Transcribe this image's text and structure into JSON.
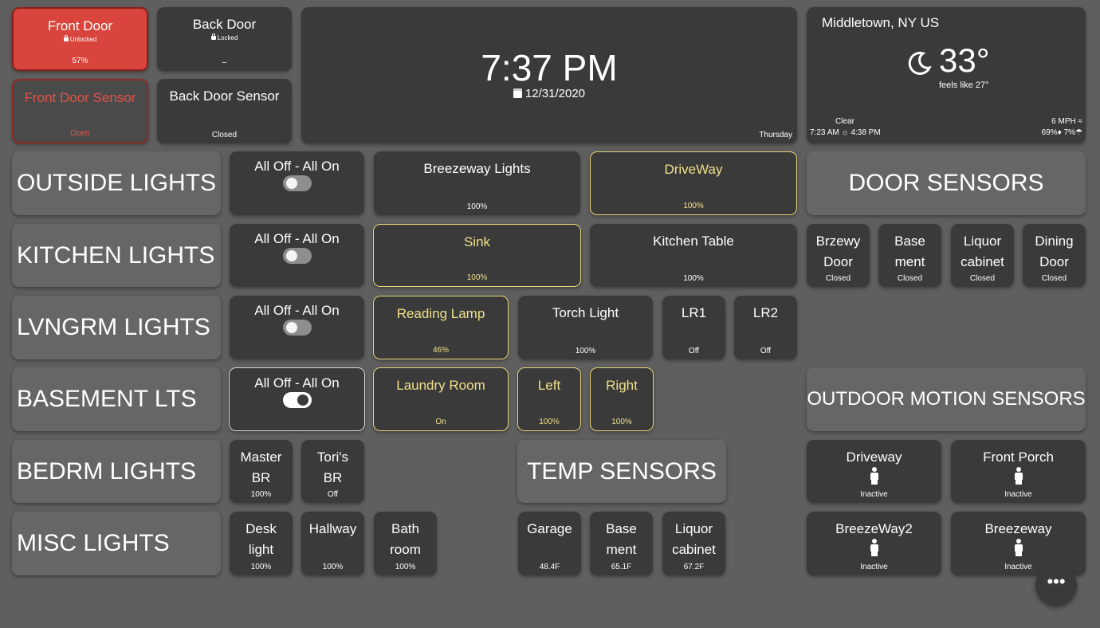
{
  "doors": {
    "front_door": {
      "name": "Front Door",
      "lock": "Unlocked",
      "status": "57%"
    },
    "back_door": {
      "name": "Back Door",
      "lock": "Locked",
      "status": "–"
    },
    "front_door_sensor": {
      "name": "Front Door Sensor",
      "status": "Open"
    },
    "back_door_sensor": {
      "name": "Back Door Sensor",
      "status": "Closed"
    }
  },
  "clock": {
    "time": "7:37 PM",
    "date": "12/31/2020",
    "weekday": "Thursday"
  },
  "weather": {
    "location": "Middletown, NY US",
    "temp": "33°",
    "feels_like": "feels like 27°",
    "condition": "Clear",
    "sunrise": "7:23 AM",
    "sunset": "4:38 PM",
    "wind": "6 MPH",
    "humidity": "69%",
    "precip": "7%"
  },
  "headers": {
    "outside": "OUTSIDE LIGHTS",
    "kitchen": "KITCHEN LIGHTS",
    "lvngrm": "LVNGRM LIGHTS",
    "basement": "BASEMENT LTS",
    "bedrm": "BEDRM LIGHTS",
    "misc": "MISC LIGHTS",
    "door_sensors": "DOOR SENSORS",
    "outdoor_motion": "OUTDOOR MOTION SENSORS",
    "temp_sensors": "TEMP SENSORS"
  },
  "toggle_label": "All Off - All On",
  "outside": {
    "breezeway": {
      "name": "Breezeway Lights",
      "status": "100%"
    },
    "driveway": {
      "name": "DriveWay",
      "status": "100%"
    }
  },
  "kitchen": {
    "sink": {
      "name": "Sink",
      "status": "100%"
    },
    "table": {
      "name": "Kitchen Table",
      "status": "100%"
    }
  },
  "lvngrm": {
    "reading": {
      "name": "Reading Lamp",
      "status": "46%"
    },
    "torch": {
      "name": "Torch Light",
      "status": "100%"
    },
    "lr1": {
      "name": "LR1",
      "status": "Off"
    },
    "lr2": {
      "name": "LR2",
      "status": "Off"
    }
  },
  "basement": {
    "laundry": {
      "name": "Laundry Room",
      "status": "On"
    },
    "left": {
      "name": "Left",
      "status": "100%"
    },
    "right": {
      "name": "Right",
      "status": "100%"
    }
  },
  "bedrm": {
    "master": {
      "line1": "Master",
      "line2": "BR",
      "status": "100%"
    },
    "tori": {
      "line1": "Tori's",
      "line2": "BR",
      "status": "Off"
    }
  },
  "misc": {
    "desk": {
      "line1": "Desk",
      "line2": "light",
      "status": "100%"
    },
    "hallway": {
      "line1": "Hallway",
      "line2": "",
      "status": "100%"
    },
    "bath": {
      "line1": "Bath",
      "line2": "room",
      "status": "100%"
    }
  },
  "door_sensor_tiles": {
    "brzewy": {
      "line1": "Brzewy",
      "line2": "Door",
      "status": "Closed"
    },
    "basement": {
      "line1": "Base",
      "line2": "ment",
      "status": "Closed"
    },
    "liquor": {
      "line1": "Liquor",
      "line2": "cabinet",
      "status": "Closed"
    },
    "dining": {
      "line1": "Dining",
      "line2": "Door",
      "status": "Closed"
    }
  },
  "temp_tiles": {
    "garage": {
      "line1": "Garage",
      "line2": "",
      "status": "48.4F"
    },
    "basement": {
      "line1": "Base",
      "line2": "ment",
      "status": "65.1F"
    },
    "liquor": {
      "line1": "Liquor",
      "line2": "cabinet",
      "status": "67.2F"
    }
  },
  "motion": {
    "driveway": {
      "name": "Driveway",
      "status": "Inactive"
    },
    "front_porch": {
      "name": "Front Porch",
      "status": "Inactive"
    },
    "breezeway2": {
      "name": "BreezeWay2",
      "status": "Inactive"
    },
    "breezeway": {
      "name": "Breezeway",
      "status": "Inactive"
    }
  },
  "fab_label": "•••",
  "colors": {
    "background": "#5f5f5f",
    "tile": "#3a3a3a",
    "header_tile": "#666666",
    "on_accent": "#f0e08a",
    "alert": "#d9453c"
  }
}
